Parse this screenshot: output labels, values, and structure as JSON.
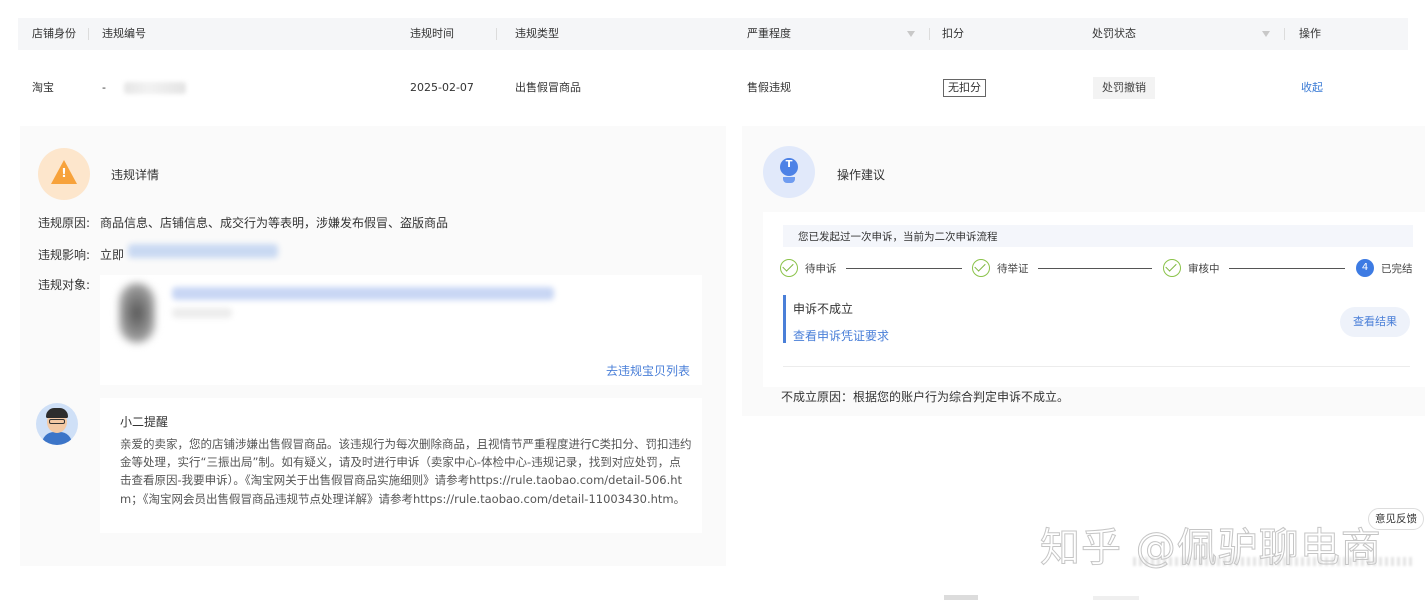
{
  "table": {
    "headers": {
      "shop_identity": "店铺身份",
      "violation_no": "违规编号",
      "violation_time": "违规时间",
      "violation_type": "违规类型",
      "severity": "严重程度",
      "deduction": "扣分",
      "penalty_status": "处罚状态",
      "action": "操作"
    },
    "row": {
      "shop_identity": "淘宝",
      "violation_no_prefix": "-",
      "violation_time": "2025-02-07",
      "violation_type": "出售假冒商品",
      "severity": "售假违规",
      "deduction": "无扣分",
      "penalty_status": "处罚撤销",
      "action": "收起"
    }
  },
  "detail": {
    "title": "违规详情",
    "reason_label": "违规原因:",
    "reason_value": "商品信息、店铺信息、成交行为等表明，涉嫌发布假冒、盗版商品",
    "impact_label": "违规影响:",
    "impact_value": "立即",
    "object_label": "违规对象:",
    "go_link": "去违规宝贝列表"
  },
  "reminder": {
    "title": "小二提醒",
    "body": "亲爱的卖家，您的店铺涉嫌出售假冒商品。该违规行为每次删除商品，且视情节严重程度进行C类扣分、罚扣违约金等处理，实行“三振出局”制。如有疑义，请及时进行申诉（卖家中心-体检中心-违规记录，找到对应处罚，点击查看原因-我要申诉）。《淘宝网关于出售假冒商品实施细则》请参考https://rule.taobao.com/detail-506.htm；《淘宝网会员出售假冒商品违规节点处理详解》请参考https://rule.taobao.com/detail-11003430.htm。"
  },
  "advice": {
    "title": "操作建议",
    "notice": "您已发起过一次申诉，当前为二次申诉流程",
    "steps": [
      {
        "label": "待申诉"
      },
      {
        "label": "待举证"
      },
      {
        "label": "审核中"
      },
      {
        "label": "已完结",
        "number": "4"
      }
    ],
    "result_title": "申诉不成立",
    "result_link": "查看申诉凭证要求",
    "view_button": "查看结果",
    "fail_reason": "不成立原因：根据您的账户行为综合判定申诉不成立。"
  },
  "feedback": "意见反馈",
  "watermark": "知乎 @佩驴聊电商",
  "colors": {
    "link": "#4a7fd8",
    "warning": "#f7a23b",
    "success": "#8bc34a",
    "step_active": "#3d7be3"
  },
  "icons": [
    "warning-icon",
    "lightbulb-icon",
    "filter-icon",
    "check-circle-icon",
    "avatar"
  ]
}
